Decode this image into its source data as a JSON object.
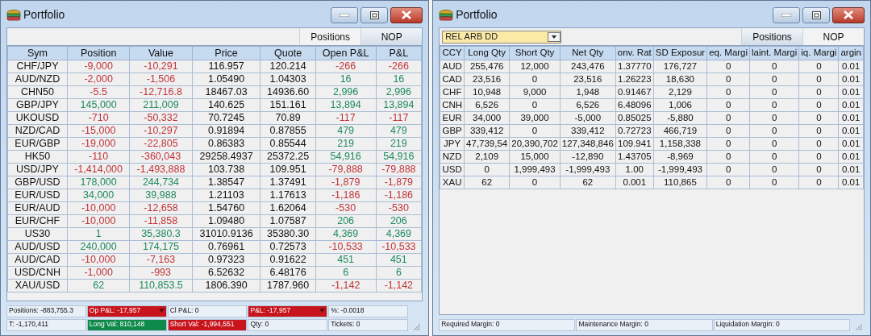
{
  "windows": [
    {
      "title": "Portfolio",
      "tabs": [
        {
          "label": "Positions",
          "selected": true
        },
        {
          "label": "NOP",
          "selected": false
        }
      ],
      "table": {
        "kind": "positions",
        "columns": [
          "Sym",
          "Position",
          "Value",
          "Price",
          "Quote",
          "Open P&L",
          "P&L"
        ],
        "rows": [
          {
            "sym": "CHF/JPY",
            "position": {
              "text": "-9,000",
              "color": "#c0343a"
            },
            "value": {
              "text": "-10,291",
              "color": "#c0343a"
            },
            "price": "116.957",
            "quote": "120.214",
            "open_pnl": {
              "text": "-266",
              "color": "#c0343a"
            },
            "pnl": {
              "text": "-266",
              "color": "#c0343a"
            }
          },
          {
            "sym": "AUD/NZD",
            "position": {
              "text": "-2,000",
              "color": "#c0343a"
            },
            "value": {
              "text": "-1,506",
              "color": "#c0343a"
            },
            "price": "1.05490",
            "quote": "1.04303",
            "open_pnl": {
              "text": "16",
              "color": "#1f8a5e"
            },
            "pnl": {
              "text": "16",
              "color": "#1f8a5e"
            }
          },
          {
            "sym": "CHN50",
            "position": {
              "text": "-5.5",
              "color": "#c0343a"
            },
            "value": {
              "text": "-12,716.8",
              "color": "#c0343a"
            },
            "price": "18467.03",
            "quote": "14936.60",
            "open_pnl": {
              "text": "2,996",
              "color": "#1f8a5e"
            },
            "pnl": {
              "text": "2,996",
              "color": "#1f8a5e"
            }
          },
          {
            "sym": "GBP/JPY",
            "position": {
              "text": "145,000",
              "color": "#1f8a5e"
            },
            "value": {
              "text": "211,009",
              "color": "#1f8a5e"
            },
            "price": "140.625",
            "quote": "151.161",
            "open_pnl": {
              "text": "13,894",
              "color": "#1f8a5e"
            },
            "pnl": {
              "text": "13,894",
              "color": "#1f8a5e"
            }
          },
          {
            "sym": "UKOUSD",
            "position": {
              "text": "-710",
              "color": "#c0343a"
            },
            "value": {
              "text": "-50,332",
              "color": "#c0343a"
            },
            "price": "70.7245",
            "quote": "70.89",
            "open_pnl": {
              "text": "-117",
              "color": "#c0343a"
            },
            "pnl": {
              "text": "-117",
              "color": "#c0343a"
            }
          },
          {
            "sym": "NZD/CAD",
            "position": {
              "text": "-15,000",
              "color": "#c0343a"
            },
            "value": {
              "text": "-10,297",
              "color": "#c0343a"
            },
            "price": "0.91894",
            "quote": "0.87855",
            "open_pnl": {
              "text": "479",
              "color": "#1f8a5e"
            },
            "pnl": {
              "text": "479",
              "color": "#1f8a5e"
            }
          },
          {
            "sym": "EUR/GBP",
            "position": {
              "text": "-19,000",
              "color": "#c0343a"
            },
            "value": {
              "text": "-22,805",
              "color": "#c0343a"
            },
            "price": "0.86383",
            "quote": "0.85544",
            "open_pnl": {
              "text": "219",
              "color": "#1f8a5e"
            },
            "pnl": {
              "text": "219",
              "color": "#1f8a5e"
            }
          },
          {
            "sym": "HK50",
            "position": {
              "text": "-110",
              "color": "#c0343a"
            },
            "value": {
              "text": "-360,043",
              "color": "#c0343a"
            },
            "price": "29258.4937",
            "quote": "25372.25",
            "open_pnl": {
              "text": "54,916",
              "color": "#1f8a5e"
            },
            "pnl": {
              "text": "54,916",
              "color": "#1f8a5e"
            }
          },
          {
            "sym": "USD/JPY",
            "position": {
              "text": "-1,414,000",
              "color": "#c0343a"
            },
            "value": {
              "text": "-1,493,888",
              "color": "#c0343a"
            },
            "price": "103.738",
            "quote": "109.951",
            "open_pnl": {
              "text": "-79,888",
              "color": "#c0343a"
            },
            "pnl": {
              "text": "-79,888",
              "color": "#c0343a"
            }
          },
          {
            "sym": "GBP/USD",
            "position": {
              "text": "178,000",
              "color": "#1f8a5e"
            },
            "value": {
              "text": "244,734",
              "color": "#1f8a5e"
            },
            "price": "1.38547",
            "quote": "1.37491",
            "open_pnl": {
              "text": "-1,879",
              "color": "#c0343a"
            },
            "pnl": {
              "text": "-1,879",
              "color": "#c0343a"
            }
          },
          {
            "sym": "EUR/USD",
            "position": {
              "text": "34,000",
              "color": "#1f8a5e"
            },
            "value": {
              "text": "39,988",
              "color": "#1f8a5e"
            },
            "price": "1.21103",
            "quote": "1.17613",
            "open_pnl": {
              "text": "-1,186",
              "color": "#c0343a"
            },
            "pnl": {
              "text": "-1,186",
              "color": "#c0343a"
            }
          },
          {
            "sym": "EUR/AUD",
            "position": {
              "text": "-10,000",
              "color": "#c0343a"
            },
            "value": {
              "text": "-12,658",
              "color": "#c0343a"
            },
            "price": "1.54760",
            "quote": "1.62064",
            "open_pnl": {
              "text": "-530",
              "color": "#c0343a"
            },
            "pnl": {
              "text": "-530",
              "color": "#c0343a"
            }
          },
          {
            "sym": "EUR/CHF",
            "position": {
              "text": "-10,000",
              "color": "#c0343a"
            },
            "value": {
              "text": "-11,858",
              "color": "#c0343a"
            },
            "price": "1.09480",
            "quote": "1.07587",
            "open_pnl": {
              "text": "206",
              "color": "#1f8a5e"
            },
            "pnl": {
              "text": "206",
              "color": "#1f8a5e"
            }
          },
          {
            "sym": "US30",
            "position": {
              "text": "1",
              "color": "#1f8a5e"
            },
            "value": {
              "text": "35,380.3",
              "color": "#1f8a5e"
            },
            "price": "31010.9136",
            "quote": "35380.30",
            "open_pnl": {
              "text": "4,369",
              "color": "#1f8a5e"
            },
            "pnl": {
              "text": "4,369",
              "color": "#1f8a5e"
            }
          },
          {
            "sym": "AUD/USD",
            "position": {
              "text": "240,000",
              "color": "#1f8a5e"
            },
            "value": {
              "text": "174,175",
              "color": "#1f8a5e"
            },
            "price": "0.76961",
            "quote": "0.72573",
            "open_pnl": {
              "text": "-10,533",
              "color": "#c0343a"
            },
            "pnl": {
              "text": "-10,533",
              "color": "#c0343a"
            }
          },
          {
            "sym": "AUD/CAD",
            "position": {
              "text": "-10,000",
              "color": "#c0343a"
            },
            "value": {
              "text": "-7,163",
              "color": "#c0343a"
            },
            "price": "0.97323",
            "quote": "0.91622",
            "open_pnl": {
              "text": "451",
              "color": "#1f8a5e"
            },
            "pnl": {
              "text": "451",
              "color": "#1f8a5e"
            }
          },
          {
            "sym": "USD/CNH",
            "position": {
              "text": "-1,000",
              "color": "#c0343a"
            },
            "value": {
              "text": "-993",
              "color": "#c0343a"
            },
            "price": "6.52632",
            "quote": "6.48176",
            "open_pnl": {
              "text": "6",
              "color": "#1f8a5e"
            },
            "pnl": {
              "text": "6",
              "color": "#1f8a5e"
            }
          },
          {
            "sym": "XAU/USD",
            "position": {
              "text": "62",
              "color": "#1f8a5e"
            },
            "value": {
              "text": "110,853.5",
              "color": "#1f8a5e"
            },
            "price": "1806.390",
            "quote": "1787.960",
            "open_pnl": {
              "text": "-1,142",
              "color": "#c0343a"
            },
            "pnl": {
              "text": "-1,142",
              "color": "#c0343a"
            }
          }
        ]
      },
      "status_bar": [
        [
          {
            "text": "Positions: -883,755.3",
            "color": "#e9f0f8",
            "dropdown": false
          },
          {
            "text": "Op P&L: -17,957",
            "color": "#c8141c",
            "dropdown": true
          },
          {
            "text": "Cl P&L: 0",
            "color": "#e9f0f8",
            "dropdown": false
          },
          {
            "text": "P&L: -17,957",
            "color": "#c8141c",
            "dropdown": true
          },
          {
            "text": "%: -0.0018",
            "color": "#e9f0f8",
            "dropdown": false
          }
        ],
        [
          {
            "text": "T: -1,170,411",
            "color": "#e9f0f8",
            "dropdown": false
          },
          {
            "text": "Long Val: 810,148",
            "color": "#0e8a4a",
            "dropdown": false
          },
          {
            "text": "Short Val: -1,994,551",
            "color": "#c8141c",
            "dropdown": false
          },
          {
            "text": "Qty: 0",
            "color": "#e9f0f8",
            "dropdown": false
          },
          {
            "text": "Tickets: 0",
            "color": "#e9f0f8",
            "dropdown": false
          }
        ]
      ]
    },
    {
      "title": "Portfolio",
      "filter": {
        "value": "REL ARB DD"
      },
      "tabs": [
        {
          "label": "Positions",
          "selected": false
        },
        {
          "label": "NOP",
          "selected": true
        }
      ],
      "table": {
        "kind": "nop",
        "columns": [
          "CCY",
          "Long Qty",
          "Short Qty",
          "Net Qty",
          "onv. Rat",
          "SD Exposur",
          "eq. Margi",
          "laint. Margi",
          "iq. Margi",
          "argin"
        ],
        "rows": [
          {
            "cells": [
              "AUD",
              "255,476",
              "12,000",
              "243,476",
              "1.37770",
              "176,727",
              "0",
              "0",
              "0",
              "0.01"
            ]
          },
          {
            "cells": [
              "CAD",
              "23,516",
              "0",
              "23,516",
              "1.26223",
              "18,630",
              "0",
              "0",
              "0",
              "0.01"
            ]
          },
          {
            "cells": [
              "CHF",
              "10,948",
              "9,000",
              "1,948",
              "0.91467",
              "2,129",
              "0",
              "0",
              "0",
              "0.01"
            ]
          },
          {
            "cells": [
              "CNH",
              "6,526",
              "0",
              "6,526",
              "6.48096",
              "1,006",
              "0",
              "0",
              "0",
              "0.01"
            ]
          },
          {
            "cells": [
              "EUR",
              "34,000",
              "39,000",
              "-5,000",
              "0.85025",
              "-5,880",
              "0",
              "0",
              "0",
              "0.01"
            ]
          },
          {
            "cells": [
              "GBP",
              "339,412",
              "0",
              "339,412",
              "0.72723",
              "466,719",
              "0",
              "0",
              "0",
              "0.01"
            ]
          },
          {
            "cells": [
              "JPY",
              "47,739,54",
              "20,390,702",
              "127,348,846",
              "109.941",
              "1,158,338",
              "0",
              "0",
              "0",
              "0.01"
            ]
          },
          {
            "cells": [
              "NZD",
              "2,109",
              "15,000",
              "-12,890",
              "1.43705",
              "-8,969",
              "0",
              "0",
              "0",
              "0.01"
            ]
          },
          {
            "cells": [
              "USD",
              "0",
              "1,999,493",
              "-1,999,493",
              "1.00",
              "-1,999,493",
              "0",
              "0",
              "0",
              "0.01"
            ]
          },
          {
            "cells": [
              "XAU",
              "62",
              "0",
              "62",
              "0.001",
              "110,865",
              "0",
              "0",
              "0",
              "0.01"
            ]
          }
        ]
      },
      "status_bar": [
        [
          {
            "text": "Required Margin: 0",
            "color": "#e9f0f8",
            "dropdown": false
          },
          {
            "text": "Maintenance Margin: 0",
            "color": "#e9f0f8",
            "dropdown": false
          },
          {
            "text": "Liquidation Margin: 0",
            "color": "#e9f0f8",
            "dropdown": false
          }
        ]
      ]
    }
  ]
}
